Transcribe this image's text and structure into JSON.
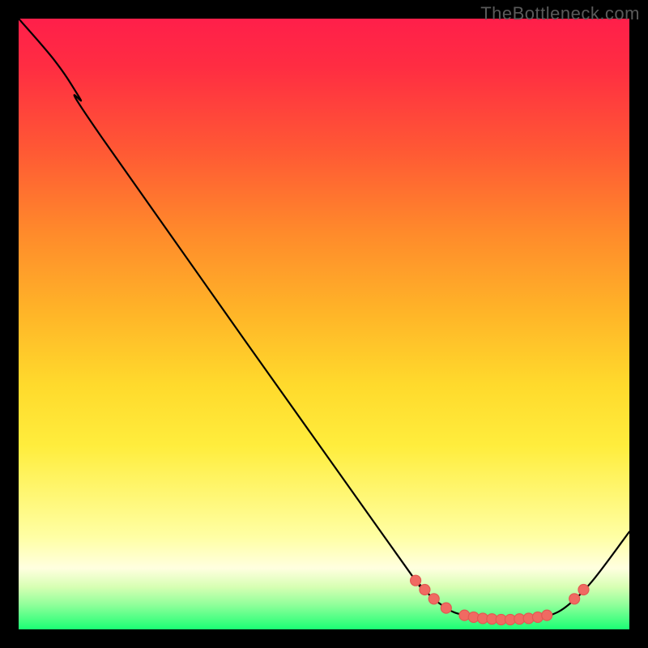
{
  "watermark": "TheBottleneck.com",
  "chart_data": {
    "type": "line",
    "title": "",
    "xlabel": "",
    "ylabel": "",
    "xlim": [
      0,
      100
    ],
    "ylim": [
      0,
      100
    ],
    "grid": false,
    "legend": false,
    "series": [
      {
        "name": "curve",
        "points": [
          {
            "x": 0,
            "y": 100
          },
          {
            "x": 6,
            "y": 93
          },
          {
            "x": 10,
            "y": 87
          },
          {
            "x": 14,
            "y": 80
          },
          {
            "x": 60,
            "y": 15
          },
          {
            "x": 66,
            "y": 7
          },
          {
            "x": 70,
            "y": 3.5
          },
          {
            "x": 73,
            "y": 2.3
          },
          {
            "x": 76,
            "y": 1.8
          },
          {
            "x": 80,
            "y": 1.6
          },
          {
            "x": 84,
            "y": 1.8
          },
          {
            "x": 87,
            "y": 2.3
          },
          {
            "x": 90,
            "y": 4
          },
          {
            "x": 94,
            "y": 8
          },
          {
            "x": 100,
            "y": 16
          }
        ]
      }
    ],
    "highlight_points": [
      {
        "x": 65,
        "y": 8.0
      },
      {
        "x": 66.5,
        "y": 6.5
      },
      {
        "x": 68,
        "y": 5.0
      },
      {
        "x": 70,
        "y": 3.5
      },
      {
        "x": 73,
        "y": 2.3
      },
      {
        "x": 74.5,
        "y": 2.0
      },
      {
        "x": 76,
        "y": 1.8
      },
      {
        "x": 77.5,
        "y": 1.7
      },
      {
        "x": 79,
        "y": 1.6
      },
      {
        "x": 80.5,
        "y": 1.6
      },
      {
        "x": 82,
        "y": 1.7
      },
      {
        "x": 83.5,
        "y": 1.8
      },
      {
        "x": 85,
        "y": 2.0
      },
      {
        "x": 86.5,
        "y": 2.3
      },
      {
        "x": 91,
        "y": 5.0
      },
      {
        "x": 92.5,
        "y": 6.5
      }
    ],
    "colors": {
      "curve": "#000000",
      "dot_fill": "#f06a62",
      "gradient_top": "#ff1f4a",
      "gradient_mid": "#ffe33a",
      "gradient_bottom": "#1bff74",
      "background": "#000000"
    }
  }
}
